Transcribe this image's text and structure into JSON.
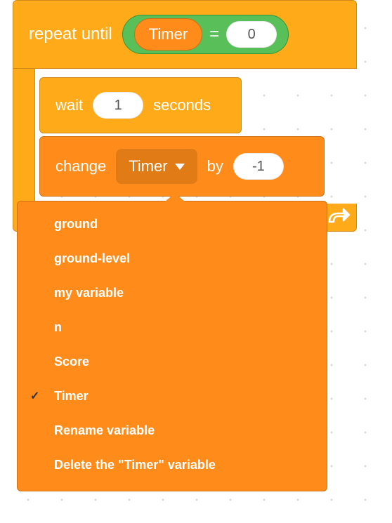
{
  "colors": {
    "control": "#ffab19",
    "controlBorder": "#cf8b17",
    "variable": "#ff8c1a",
    "variableBorder": "#cf7014",
    "operator": "#59c059",
    "operatorBorder": "#389438",
    "white": "#ffffff"
  },
  "repeatUntil": {
    "label": "repeat until",
    "condition": {
      "var": "Timer",
      "op": "=",
      "value": "0"
    }
  },
  "wait": {
    "prefix": "wait",
    "value": "1",
    "suffix": "seconds"
  },
  "change": {
    "prefix": "change",
    "variable": "Timer",
    "by": "by",
    "value": "-1"
  },
  "menu": {
    "items": [
      {
        "label": "ground",
        "checked": false
      },
      {
        "label": "ground-level",
        "checked": false
      },
      {
        "label": "my variable",
        "checked": false
      },
      {
        "label": "n",
        "checked": false
      },
      {
        "label": "Score",
        "checked": false
      },
      {
        "label": "Timer",
        "checked": true
      },
      {
        "label": "Rename variable",
        "checked": false
      },
      {
        "label": "Delete the \"Timer\" variable",
        "checked": false
      }
    ]
  }
}
